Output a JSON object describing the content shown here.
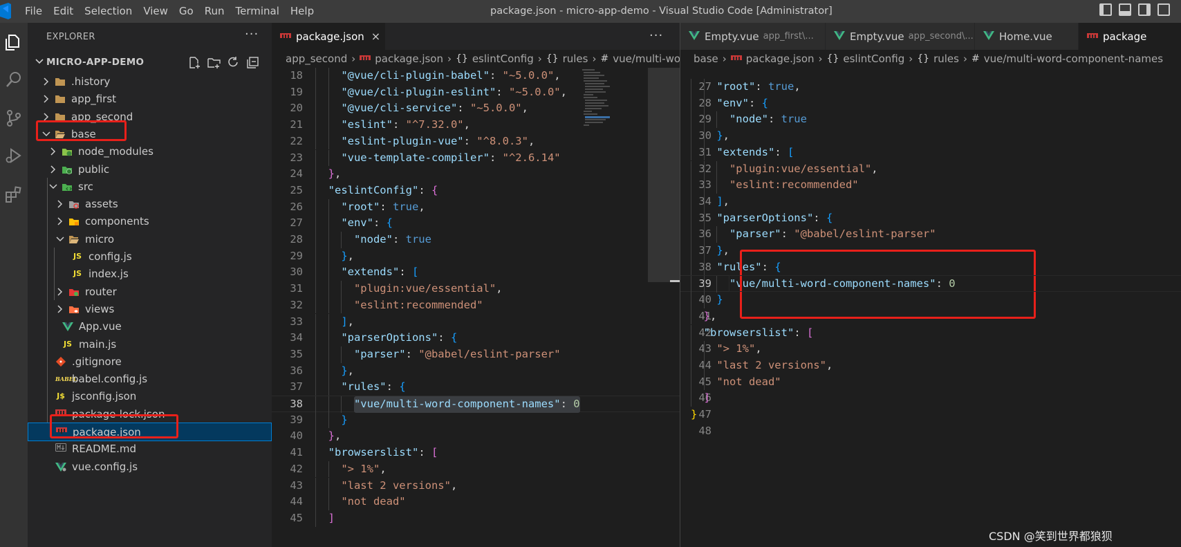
{
  "window": {
    "title": "package.json - micro-app-demo - Visual Studio Code [Administrator]",
    "menu": [
      "File",
      "Edit",
      "Selection",
      "View",
      "Go",
      "Run",
      "Terminal",
      "Help"
    ]
  },
  "activity_bar": {
    "items": [
      "explorer-icon",
      "search-icon",
      "source-control-icon",
      "run-debug-icon",
      "extensions-icon"
    ]
  },
  "sidebar": {
    "title": "EXPLORER",
    "more": "···",
    "root": "MICRO-APP-DEMO",
    "root_actions": [
      "new-file-icon",
      "new-folder-icon",
      "refresh-icon",
      "collapse-all-icon"
    ],
    "tree": [
      {
        "name": ".history",
        "type": "folder",
        "expanded": false,
        "depth": 0,
        "icon": "folder-icon"
      },
      {
        "name": "app_first",
        "type": "folder",
        "expanded": false,
        "depth": 0,
        "icon": "folder-icon"
      },
      {
        "name": "app_second",
        "type": "folder",
        "expanded": false,
        "depth": 0,
        "icon": "folder-icon"
      },
      {
        "name": "base",
        "type": "folder",
        "expanded": true,
        "depth": 0,
        "icon": "folder-open-icon",
        "highlighted": true
      },
      {
        "name": "node_modules",
        "type": "folder",
        "expanded": false,
        "depth": 1,
        "icon": "node-modules-folder-icon"
      },
      {
        "name": "public",
        "type": "folder",
        "expanded": false,
        "depth": 1,
        "icon": "public-folder-icon"
      },
      {
        "name": "src",
        "type": "folder",
        "expanded": true,
        "depth": 1,
        "icon": "src-folder-icon"
      },
      {
        "name": "assets",
        "type": "folder",
        "expanded": false,
        "depth": 2,
        "icon": "assets-folder-icon"
      },
      {
        "name": "components",
        "type": "folder",
        "expanded": false,
        "depth": 2,
        "icon": "components-folder-icon"
      },
      {
        "name": "micro",
        "type": "folder",
        "expanded": true,
        "depth": 2,
        "icon": "folder-open-icon"
      },
      {
        "name": "config.js",
        "type": "file",
        "depth": 3,
        "icon": "js-file-icon"
      },
      {
        "name": "index.js",
        "type": "file",
        "depth": 3,
        "icon": "js-file-icon"
      },
      {
        "name": "router",
        "type": "folder",
        "expanded": false,
        "depth": 2,
        "icon": "router-folder-icon"
      },
      {
        "name": "views",
        "type": "folder",
        "expanded": false,
        "depth": 2,
        "icon": "views-folder-icon"
      },
      {
        "name": "App.vue",
        "type": "file",
        "depth": 2,
        "icon": "vue-file-icon"
      },
      {
        "name": "main.js",
        "type": "file",
        "depth": 2,
        "icon": "js-file-icon"
      },
      {
        "name": ".gitignore",
        "type": "file",
        "depth": 1,
        "icon": "git-file-icon"
      },
      {
        "name": "babel.config.js",
        "type": "file",
        "depth": 1,
        "icon": "babel-file-icon"
      },
      {
        "name": "jsconfig.json",
        "type": "file",
        "depth": 1,
        "icon": "jsconfig-file-icon"
      },
      {
        "name": "package-lock.json",
        "type": "file",
        "depth": 1,
        "icon": "npm-file-icon"
      },
      {
        "name": "package.json",
        "type": "file",
        "depth": 1,
        "icon": "npm-file-icon",
        "selected": true,
        "highlighted": true
      },
      {
        "name": "README.md",
        "type": "file",
        "depth": 1,
        "icon": "markdown-file-icon"
      },
      {
        "name": "vue.config.js",
        "type": "file",
        "depth": 1,
        "icon": "vue-config-file-icon"
      }
    ]
  },
  "editor_left": {
    "tabs": [
      {
        "label": "package.json",
        "icon": "npm-file-icon",
        "active": true,
        "close": "×"
      }
    ],
    "more": "···",
    "breadcrumb": [
      {
        "label": "app_second",
        "icon": ""
      },
      {
        "label": "package.json",
        "icon": "npm-file-icon"
      },
      {
        "label": "eslintConfig",
        "icon": "{}"
      },
      {
        "label": "rules",
        "icon": "{}"
      },
      {
        "label": "vue/multi-wo",
        "icon": "#"
      }
    ],
    "current_line": 38,
    "lines": [
      {
        "n": 18,
        "indent": 2,
        "tokens": [
          [
            "key",
            "\"@vue/cli-plugin-babel\""
          ],
          [
            "p",
            ": "
          ],
          [
            "str",
            "\"~5.0.0\""
          ],
          [
            "p",
            ","
          ]
        ]
      },
      {
        "n": 19,
        "indent": 2,
        "tokens": [
          [
            "key",
            "\"@vue/cli-plugin-eslint\""
          ],
          [
            "p",
            ": "
          ],
          [
            "str",
            "\"~5.0.0\""
          ],
          [
            "p",
            ","
          ]
        ]
      },
      {
        "n": 20,
        "indent": 2,
        "tokens": [
          [
            "key",
            "\"@vue/cli-service\""
          ],
          [
            "p",
            ": "
          ],
          [
            "str",
            "\"~5.0.0\""
          ],
          [
            "p",
            ","
          ]
        ]
      },
      {
        "n": 21,
        "indent": 2,
        "tokens": [
          [
            "key",
            "\"eslint\""
          ],
          [
            "p",
            ": "
          ],
          [
            "str",
            "\"^7.32.0\""
          ],
          [
            "p",
            ","
          ]
        ]
      },
      {
        "n": 22,
        "indent": 2,
        "tokens": [
          [
            "key",
            "\"eslint-plugin-vue\""
          ],
          [
            "p",
            ": "
          ],
          [
            "str",
            "\"^8.0.3\""
          ],
          [
            "p",
            ","
          ]
        ]
      },
      {
        "n": 23,
        "indent": 2,
        "tokens": [
          [
            "key",
            "\"vue-template-compiler\""
          ],
          [
            "p",
            ": "
          ],
          [
            "str",
            "\"^2.6.14\""
          ]
        ]
      },
      {
        "n": 24,
        "indent": 1,
        "tokens": [
          [
            "b1",
            "}"
          ],
          [
            "p",
            ","
          ]
        ]
      },
      {
        "n": 25,
        "indent": 1,
        "tokens": [
          [
            "key",
            "\"eslintConfig\""
          ],
          [
            "p",
            ": "
          ],
          [
            "b1",
            "{"
          ]
        ]
      },
      {
        "n": 26,
        "indent": 2,
        "tokens": [
          [
            "key",
            "\"root\""
          ],
          [
            "p",
            ": "
          ],
          [
            "kw",
            "true"
          ],
          [
            "p",
            ","
          ]
        ]
      },
      {
        "n": 27,
        "indent": 2,
        "tokens": [
          [
            "key",
            "\"env\""
          ],
          [
            "p",
            ": "
          ],
          [
            "b2",
            "{"
          ]
        ]
      },
      {
        "n": 28,
        "indent": 3,
        "tokens": [
          [
            "key",
            "\"node\""
          ],
          [
            "p",
            ": "
          ],
          [
            "kw",
            "true"
          ]
        ]
      },
      {
        "n": 29,
        "indent": 2,
        "tokens": [
          [
            "b2",
            "}"
          ],
          [
            "p",
            ","
          ]
        ]
      },
      {
        "n": 30,
        "indent": 2,
        "tokens": [
          [
            "key",
            "\"extends\""
          ],
          [
            "p",
            ": "
          ],
          [
            "b2",
            "["
          ]
        ]
      },
      {
        "n": 31,
        "indent": 3,
        "tokens": [
          [
            "str",
            "\"plugin:vue/essential\""
          ],
          [
            "p",
            ","
          ]
        ]
      },
      {
        "n": 32,
        "indent": 3,
        "tokens": [
          [
            "str",
            "\"eslint:recommended\""
          ]
        ]
      },
      {
        "n": 33,
        "indent": 2,
        "tokens": [
          [
            "b2",
            "]"
          ],
          [
            "p",
            ","
          ]
        ]
      },
      {
        "n": 34,
        "indent": 2,
        "tokens": [
          [
            "key",
            "\"parserOptions\""
          ],
          [
            "p",
            ": "
          ],
          [
            "b2",
            "{"
          ]
        ]
      },
      {
        "n": 35,
        "indent": 3,
        "tokens": [
          [
            "key",
            "\"parser\""
          ],
          [
            "p",
            ": "
          ],
          [
            "str",
            "\"@babel/eslint-parser\""
          ]
        ]
      },
      {
        "n": 36,
        "indent": 2,
        "tokens": [
          [
            "b2",
            "}"
          ],
          [
            "p",
            ","
          ]
        ]
      },
      {
        "n": 37,
        "indent": 2,
        "tokens": [
          [
            "key",
            "\"rules\""
          ],
          [
            "p",
            ": "
          ],
          [
            "b2",
            "{"
          ]
        ]
      },
      {
        "n": 38,
        "indent": 3,
        "tokens": [
          [
            "key",
            "\"vue/multi-word-component-names\""
          ],
          [
            "p",
            ": "
          ],
          [
            "num",
            "0"
          ]
        ],
        "selected": true
      },
      {
        "n": 39,
        "indent": 2,
        "tokens": [
          [
            "b2",
            "}"
          ]
        ]
      },
      {
        "n": 40,
        "indent": 1,
        "tokens": [
          [
            "b1",
            "}"
          ],
          [
            "p",
            ","
          ]
        ]
      },
      {
        "n": 41,
        "indent": 1,
        "tokens": [
          [
            "key",
            "\"browserslist\""
          ],
          [
            "p",
            ": "
          ],
          [
            "b1",
            "["
          ]
        ]
      },
      {
        "n": 42,
        "indent": 2,
        "tokens": [
          [
            "str",
            "\"> 1%\""
          ],
          [
            "p",
            ","
          ]
        ]
      },
      {
        "n": 43,
        "indent": 2,
        "tokens": [
          [
            "str",
            "\"last 2 versions\""
          ],
          [
            "p",
            ","
          ]
        ]
      },
      {
        "n": 44,
        "indent": 2,
        "tokens": [
          [
            "str",
            "\"not dead\""
          ]
        ]
      },
      {
        "n": 45,
        "indent": 1,
        "tokens": [
          [
            "b1",
            "]"
          ]
        ]
      }
    ]
  },
  "editor_right": {
    "tabs": [
      {
        "label": "Empty.vue",
        "desc": "app_first\\...",
        "icon": "vue-file-icon",
        "active": false
      },
      {
        "label": "Empty.vue",
        "desc": "app_second\\...",
        "icon": "vue-file-icon",
        "active": false
      },
      {
        "label": "Home.vue",
        "desc": "",
        "icon": "vue-file-icon",
        "active": false
      },
      {
        "label": "package",
        "desc": "",
        "icon": "npm-file-icon",
        "active": true
      }
    ],
    "breadcrumb": [
      {
        "label": "base",
        "icon": ""
      },
      {
        "label": "package.json",
        "icon": "npm-file-icon"
      },
      {
        "label": "eslintConfig",
        "icon": "{}"
      },
      {
        "label": "rules",
        "icon": "{}"
      },
      {
        "label": "vue/multi-word-component-names",
        "icon": "#"
      }
    ],
    "current_line": 39,
    "lines": [
      {
        "n": 27,
        "indent": 2,
        "tokens": [
          [
            "key",
            "\"root\""
          ],
          [
            "p",
            ": "
          ],
          [
            "kw",
            "true"
          ],
          [
            "p",
            ","
          ]
        ]
      },
      {
        "n": 28,
        "indent": 2,
        "tokens": [
          [
            "key",
            "\"env\""
          ],
          [
            "p",
            ": "
          ],
          [
            "b2",
            "{"
          ]
        ]
      },
      {
        "n": 29,
        "indent": 3,
        "tokens": [
          [
            "key",
            "\"node\""
          ],
          [
            "p",
            ": "
          ],
          [
            "kw",
            "true"
          ]
        ]
      },
      {
        "n": 30,
        "indent": 2,
        "tokens": [
          [
            "b2",
            "}"
          ],
          [
            "p",
            ","
          ]
        ]
      },
      {
        "n": 31,
        "indent": 2,
        "tokens": [
          [
            "key",
            "\"extends\""
          ],
          [
            "p",
            ": "
          ],
          [
            "b2",
            "["
          ]
        ]
      },
      {
        "n": 32,
        "indent": 3,
        "tokens": [
          [
            "str",
            "\"plugin:vue/essential\""
          ],
          [
            "p",
            ","
          ]
        ]
      },
      {
        "n": 33,
        "indent": 3,
        "tokens": [
          [
            "str",
            "\"eslint:recommended\""
          ]
        ]
      },
      {
        "n": 34,
        "indent": 2,
        "tokens": [
          [
            "b2",
            "]"
          ],
          [
            "p",
            ","
          ]
        ]
      },
      {
        "n": 35,
        "indent": 2,
        "tokens": [
          [
            "key",
            "\"parserOptions\""
          ],
          [
            "p",
            ": "
          ],
          [
            "b2",
            "{"
          ]
        ]
      },
      {
        "n": 36,
        "indent": 3,
        "tokens": [
          [
            "key",
            "\"parser\""
          ],
          [
            "p",
            ": "
          ],
          [
            "str",
            "\"@babel/eslint-parser\""
          ]
        ]
      },
      {
        "n": 37,
        "indent": 2,
        "tokens": [
          [
            "b2",
            "}"
          ],
          [
            "p",
            ","
          ]
        ]
      },
      {
        "n": 38,
        "indent": 2,
        "tokens": [
          [
            "key",
            "\"rules\""
          ],
          [
            "p",
            ": "
          ],
          [
            "b2",
            "{"
          ]
        ]
      },
      {
        "n": 39,
        "indent": 3,
        "tokens": [
          [
            "key",
            "\"vue/multi-word-component-names\""
          ],
          [
            "p",
            ": "
          ],
          [
            "num",
            "0"
          ]
        ]
      },
      {
        "n": 40,
        "indent": 2,
        "tokens": [
          [
            "b2",
            "}"
          ]
        ]
      },
      {
        "n": 41,
        "indent": 1,
        "tokens": [
          [
            "b1",
            "}"
          ],
          [
            "p",
            ","
          ]
        ]
      },
      {
        "n": 42,
        "indent": 1,
        "tokens": [
          [
            "key",
            "\"browserslist\""
          ],
          [
            "p",
            ": "
          ],
          [
            "b1",
            "["
          ]
        ]
      },
      {
        "n": 43,
        "indent": 2,
        "tokens": [
          [
            "str",
            "\"> 1%\""
          ],
          [
            "p",
            ","
          ]
        ]
      },
      {
        "n": 44,
        "indent": 2,
        "tokens": [
          [
            "str",
            "\"last 2 versions\""
          ],
          [
            "p",
            ","
          ]
        ]
      },
      {
        "n": 45,
        "indent": 2,
        "tokens": [
          [
            "str",
            "\"not dead\""
          ]
        ]
      },
      {
        "n": 46,
        "indent": 1,
        "tokens": [
          [
            "b1",
            "]"
          ]
        ]
      },
      {
        "n": 47,
        "indent": 0,
        "tokens": [
          [
            "b0",
            "}"
          ]
        ]
      },
      {
        "n": 48,
        "indent": 0,
        "tokens": []
      }
    ]
  },
  "watermark": "CSDN @笑到世界都狼狈",
  "colors": {
    "highlight_box": "#e8201a",
    "selection": "#04395e",
    "accent": "#007fd4"
  }
}
